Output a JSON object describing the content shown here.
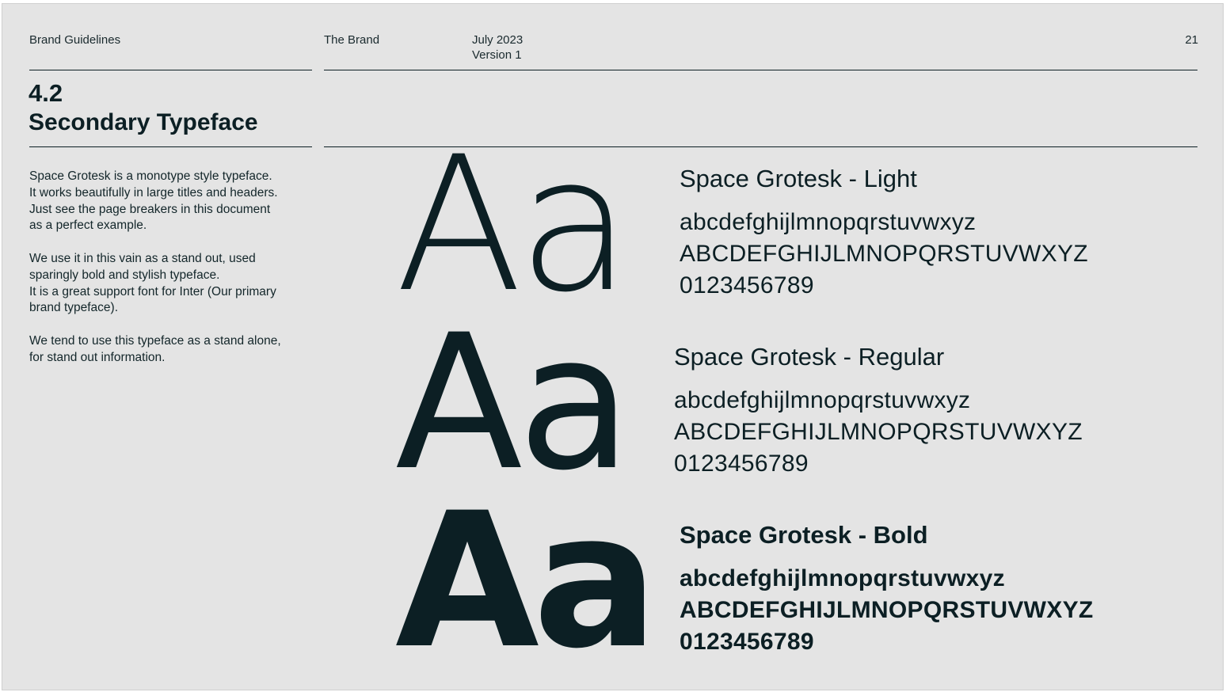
{
  "header": {
    "doc_title": "Brand Guidelines",
    "section": "The Brand",
    "date": "July 2023",
    "version": "Version 1",
    "page_number": "21"
  },
  "section": {
    "number": "4.2",
    "title": "Secondary Typeface"
  },
  "body": {
    "paragraph_1": [
      "Space Grotesk is a monotype style typeface.",
      "It works beautifully in large titles and headers.",
      "Just see the page breakers in this document",
      "as a perfect example."
    ],
    "paragraph_2": [
      "We use it in this vain as a stand out, used",
      "sparingly bold and stylish typeface.",
      "It is a great support font for Inter (Our primary",
      "brand typeface)."
    ],
    "paragraph_3": [
      "We tend to use this typeface as a stand alone,",
      "for stand out information."
    ]
  },
  "specimens": [
    {
      "glyph": "Aa",
      "name": "Space Grotesk - Light",
      "lowercase": "abcdefghijlmnopqrstuvwxyz",
      "uppercase": "ABCDEFGHIJLMNOPQRSTUVWXYZ",
      "numerals": "0123456789"
    },
    {
      "glyph": "Aa",
      "name": "Space Grotesk - Regular",
      "lowercase": "abcdefghijlmnopqrstuvwxyz",
      "uppercase": "ABCDEFGHIJLMNOPQRSTUVWXYZ",
      "numerals": "0123456789"
    },
    {
      "glyph": "Aa",
      "name": "Space Grotesk - Bold",
      "lowercase": "abcdefghijlmnopqrstuvwxyz",
      "uppercase": "ABCDEFGHIJLMNOPQRSTUVWXYZ",
      "numerals": "0123456789"
    }
  ],
  "colors": {
    "page_background": "#e4e4e4",
    "ink": "#0c1f24"
  }
}
